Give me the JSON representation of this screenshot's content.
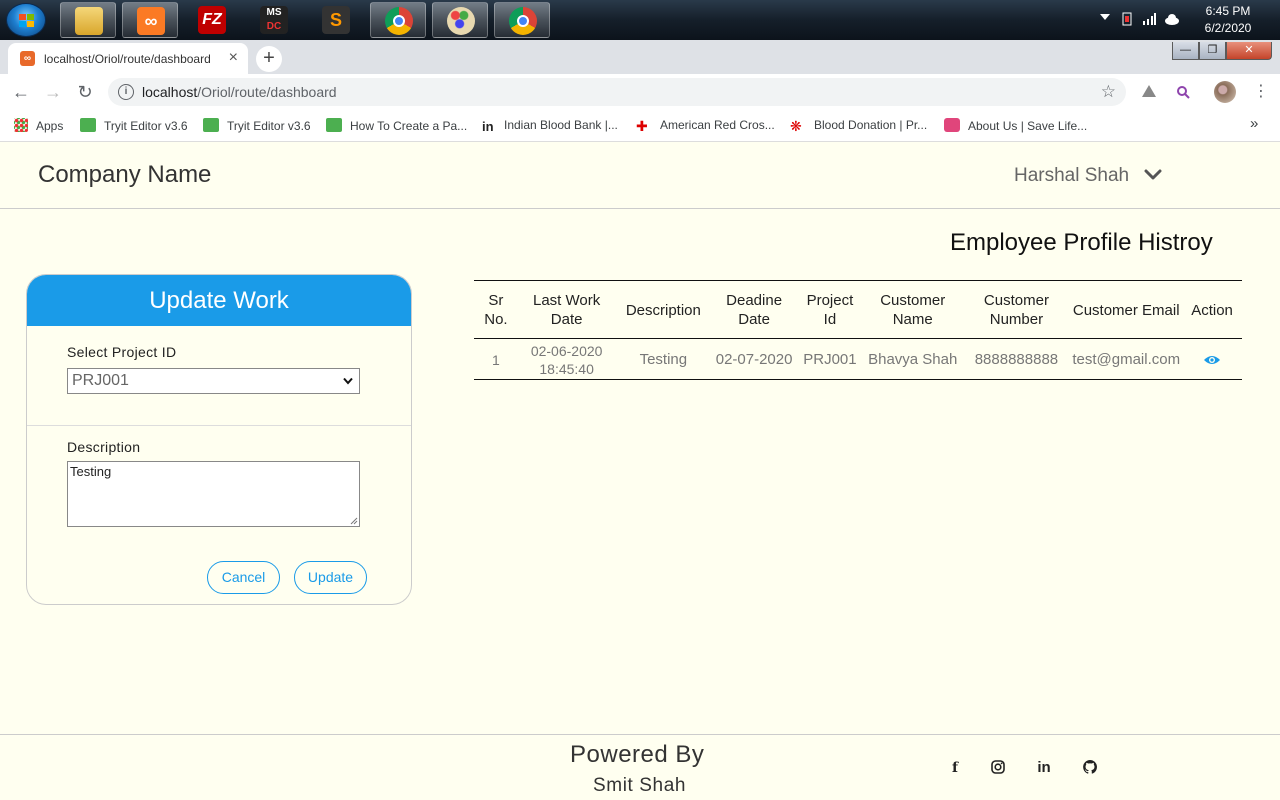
{
  "taskbar": {
    "time": "6:45 PM",
    "date": "6/2/2020",
    "apps": [
      "explorer-icon",
      "xampp-icon",
      "filezilla-icon",
      "ms-office-icon",
      "sublime-icon",
      "chrome-icon",
      "paint-icon",
      "chrome-icon"
    ]
  },
  "browser": {
    "tab_title": "localhost/Oriol/route/dashboard",
    "url_host": "localhost",
    "url_path": "/Oriol/route/dashboard",
    "bookmarks": [
      "Apps",
      "Tryit Editor v3.6",
      "Tryit Editor v3.6",
      "How To Create a Pa...",
      "Indian Blood Bank |...",
      "American Red Cros...",
      "Blood Donation | Pr...",
      "About Us | Save Life..."
    ]
  },
  "header": {
    "company": "Company Name",
    "user": "Harshal Shah"
  },
  "section_title": "Employee Profile Histroy",
  "form": {
    "title": "Update Work",
    "project_label": "Select Project ID",
    "project_value": "PRJ001",
    "description_label": "Description",
    "description_value": "Testing",
    "cancel": "Cancel",
    "update": "Update"
  },
  "table": {
    "headers": [
      "Sr No.",
      "Last Work Date",
      "Description",
      "Deadine Date",
      "Project Id",
      "Customer Name",
      "Customer Number",
      "Customer Email",
      "Action"
    ],
    "rows": [
      {
        "sr": "1",
        "last_work_date": "02-06-2020 18:45:40",
        "description": "Testing",
        "deadline": "02-07-2020",
        "project_id": "PRJ001",
        "customer_name": "Bhavya Shah",
        "customer_number": "8888888888",
        "customer_email": "test@gmail.com",
        "action_icon": "eye-icon"
      }
    ]
  },
  "footer": {
    "powered_by": "Powered By",
    "author": "Smit Shah",
    "social": [
      "facebook-icon",
      "instagram-icon",
      "linkedin-icon",
      "github-icon"
    ]
  },
  "colors": {
    "accent": "#1a9be8",
    "page_bg": "#fffff0"
  }
}
